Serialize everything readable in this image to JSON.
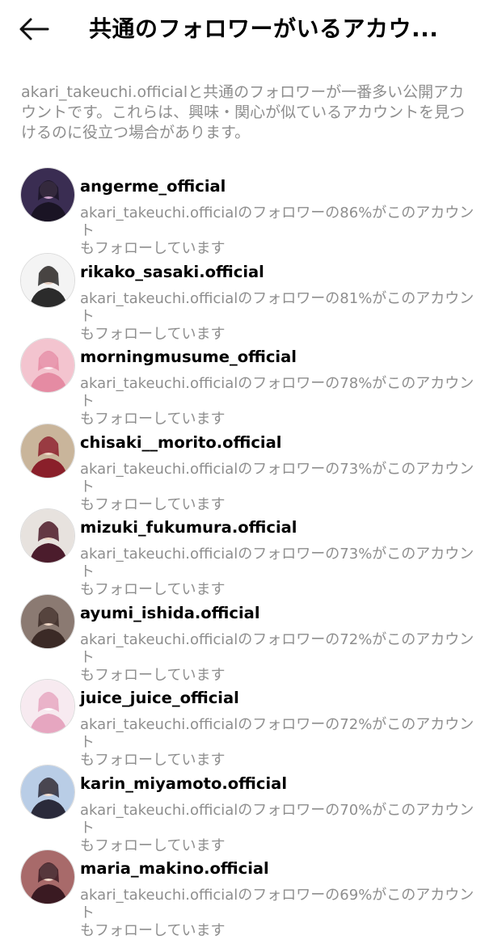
{
  "header": {
    "title": "共通のフォロワーがいるアカウ...",
    "back_icon": "arrow-left-icon"
  },
  "description": "akari_takeuchi.officialと共通のフォロワーが一番多い公開アカウントです。これらは、興味・関心が似ているアカウントを見つけるのに役立つ場合があります。",
  "accounts": [
    {
      "username": "angerme_official",
      "line1": "akari_takeuchi.officialのフォロワーの86%がこのアカウント",
      "line2": "もフォローしています",
      "avatar": {
        "bg": "#3a2d52",
        "fg": "#1a1424",
        "accent": "#c9a0c8"
      }
    },
    {
      "username": "rikako_sasaki.official",
      "line1": "akari_takeuchi.officialのフォロワーの81%がこのアカウント",
      "line2": "もフォローしています",
      "avatar": {
        "bg": "#f4f4f4",
        "fg": "#2b2b2b",
        "accent": "#e8d2c4"
      }
    },
    {
      "username": "morningmusume_official",
      "line1": "akari_takeuchi.officialのフォロワーの78%がこのアカウント",
      "line2": "もフォローしています",
      "avatar": {
        "bg": "#f3c4cf",
        "fg": "#e58ba3",
        "accent": "#fff0f4"
      }
    },
    {
      "username": "chisaki__morito.official",
      "line1": "akari_takeuchi.officialのフォロワーの73%がこのアカウント",
      "line2": "もフォローしています",
      "avatar": {
        "bg": "#c9b59b",
        "fg": "#8a1f2a",
        "accent": "#f1d9c7"
      }
    },
    {
      "username": "mizuki_fukumura.official",
      "line1": "akari_takeuchi.officialのフォロワーの73%がこのアカウント",
      "line2": "もフォローしています",
      "avatar": {
        "bg": "#e7e2de",
        "fg": "#4b1c2c",
        "accent": "#efd6c6"
      }
    },
    {
      "username": "ayumi_ishida.official",
      "line1": "akari_takeuchi.officialのフォロワーの72%がこのアカウント",
      "line2": "もフォローしています",
      "avatar": {
        "bg": "#8b7a72",
        "fg": "#3b2a26",
        "accent": "#f0d7c6"
      }
    },
    {
      "username": "juice_juice_official",
      "line1": "akari_takeuchi.officialのフォロワーの72%がこのアカウント",
      "line2": "もフォローしています",
      "avatar": {
        "bg": "#f7eaf0",
        "fg": "#e6a6c0",
        "accent": "#ffffff"
      }
    },
    {
      "username": "karin_miyamoto.official",
      "line1": "akari_takeuchi.officialのフォロワーの70%がこのアカウント",
      "line2": "もフォローしています",
      "avatar": {
        "bg": "#b9cde6",
        "fg": "#2a2a3a",
        "accent": "#f4e0d2"
      }
    },
    {
      "username": "maria_makino.official",
      "line1": "akari_takeuchi.officialのフォロワーの69%がこのアカウント",
      "line2": "もフォローしています",
      "avatar": {
        "bg": "#a86a6a",
        "fg": "#3a1a22",
        "accent": "#f3dccd"
      }
    }
  ]
}
